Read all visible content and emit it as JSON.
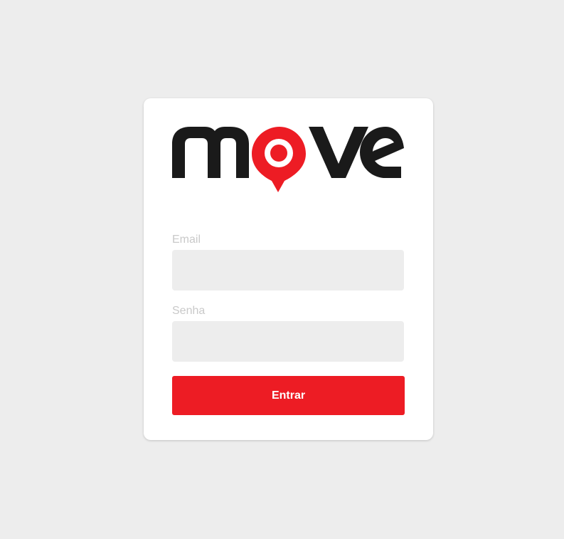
{
  "brand": {
    "logo_text": "move",
    "dark_color": "#1a1a1a",
    "accent_color": "#ed1c24"
  },
  "login": {
    "email_label": "Email",
    "email_value": "",
    "password_label": "Senha",
    "password_value": "",
    "submit_label": "Entrar"
  },
  "colors": {
    "page_background": "#ededed",
    "card_background": "#ffffff",
    "input_background": "#ededed",
    "label_color": "#c9c9c9",
    "button_background": "#ed1c24",
    "button_text": "#ffffff"
  }
}
